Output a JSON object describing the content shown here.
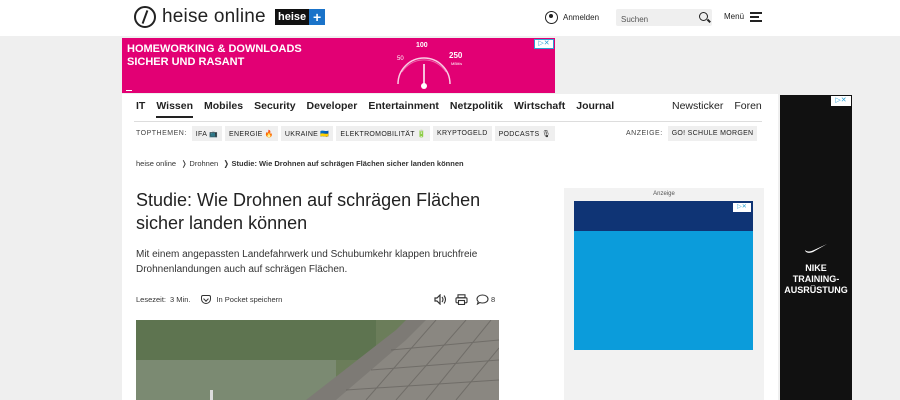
{
  "header": {
    "logo_text": "heise online",
    "heiseplus_label": "heise",
    "heiseplus_plus": "+",
    "login_label": "Anmelden",
    "search_placeholder": "Suchen",
    "menu_label": "Menü"
  },
  "top_ad": {
    "headline_line1": "HOMEWORKING & DOWNLOADS",
    "headline_line2": "SICHER UND RASANT",
    "gauge_100": "100",
    "gauge_50": "50",
    "gauge_250": "250",
    "gauge_unit": "MBit/s",
    "ad_marker": "▷✕",
    "brand_color": "#e20074"
  },
  "nav": {
    "items": [
      "IT",
      "Wissen",
      "Mobiles",
      "Security",
      "Developer",
      "Entertainment",
      "Netzpolitik",
      "Wirtschaft",
      "Journal"
    ],
    "active": "Wissen",
    "right": [
      "Newsticker",
      "Foren"
    ]
  },
  "topics": {
    "label": "TOPTHEMEN:",
    "chips": [
      "IFA 📺",
      "ENERGIE 🔥",
      "UKRAINE 🇺🇦",
      "ELEKTROMOBILITÄT 🔋",
      "KRYPTOGELD",
      "PODCASTS 🎙"
    ],
    "ad_label": "ANZEIGE:",
    "ad_chip": "GO! SCHULE MORGEN"
  },
  "breadcrumb": {
    "items": [
      "heise online",
      "❭ Drohnen",
      "❭ Studie: Wie Drohnen auf schrägen Flächen sicher landen können"
    ]
  },
  "article": {
    "title": "Studie: Wie Drohnen auf schrägen Flächen sicher landen können",
    "lead": "Mit einem angepassten Landefahrwerk und Schubumkehr klappen bruchfreie Drohnenlandungen auch auf schrägen Flächen.",
    "reading_time_label": "Lesezeit:",
    "reading_time_value": "3 Min.",
    "pocket_label": "In Pocket speichern",
    "comment_count": "8"
  },
  "side_ad": {
    "label": "Anzeige",
    "ad_marker": "▷✕"
  },
  "sky_ad": {
    "text_line1": "NIKE",
    "text_line2": "TRAINING-",
    "text_line3": "AUSRÜSTUNG",
    "ad_marker": "▷✕"
  }
}
